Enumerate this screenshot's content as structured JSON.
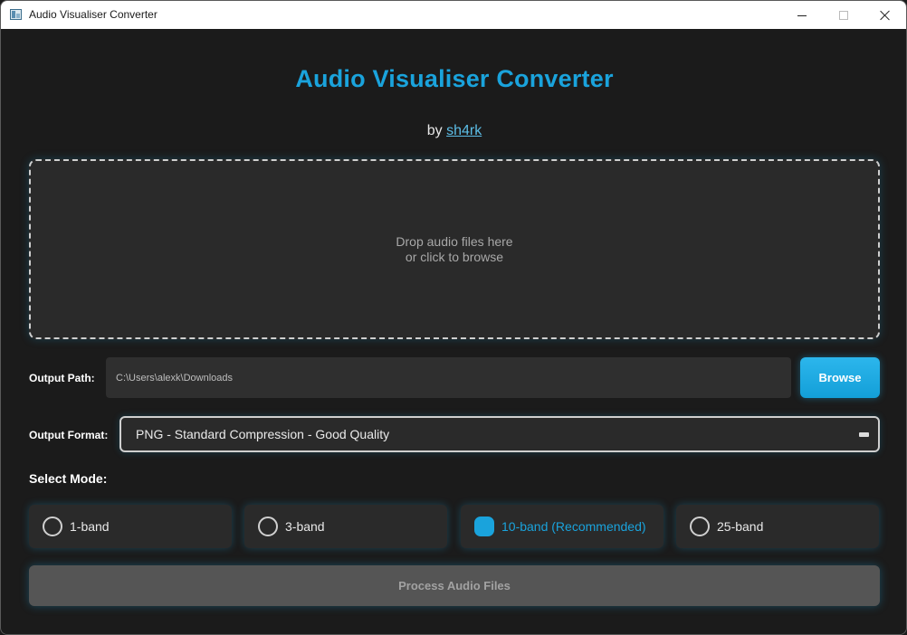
{
  "window": {
    "title": "Audio Visualiser Converter",
    "icon": "app-icon"
  },
  "header": {
    "title": "Audio Visualiser Converter",
    "by_prefix": "by",
    "author_link": "sh4rk"
  },
  "dropzone": {
    "line1": "Drop audio files here",
    "line2": "or click to browse"
  },
  "output_path": {
    "label": "Output Path:",
    "value": "C:\\Users\\alexk\\Downloads",
    "browse_label": "Browse"
  },
  "output_format": {
    "label": "Output Format:",
    "selected": "PNG - Standard Compression - Good Quality"
  },
  "mode": {
    "label": "Select Mode:",
    "options": [
      {
        "label": "1-band",
        "selected": false
      },
      {
        "label": "3-band",
        "selected": false
      },
      {
        "label": "10-band (Recommended)",
        "selected": true
      },
      {
        "label": "25-band",
        "selected": false
      }
    ]
  },
  "process": {
    "label": "Process Audio Files"
  },
  "colors": {
    "accent": "#1aa3dc",
    "background": "#1b1b1b",
    "panel": "#2a2a2a",
    "disabled_button": "#555555"
  }
}
